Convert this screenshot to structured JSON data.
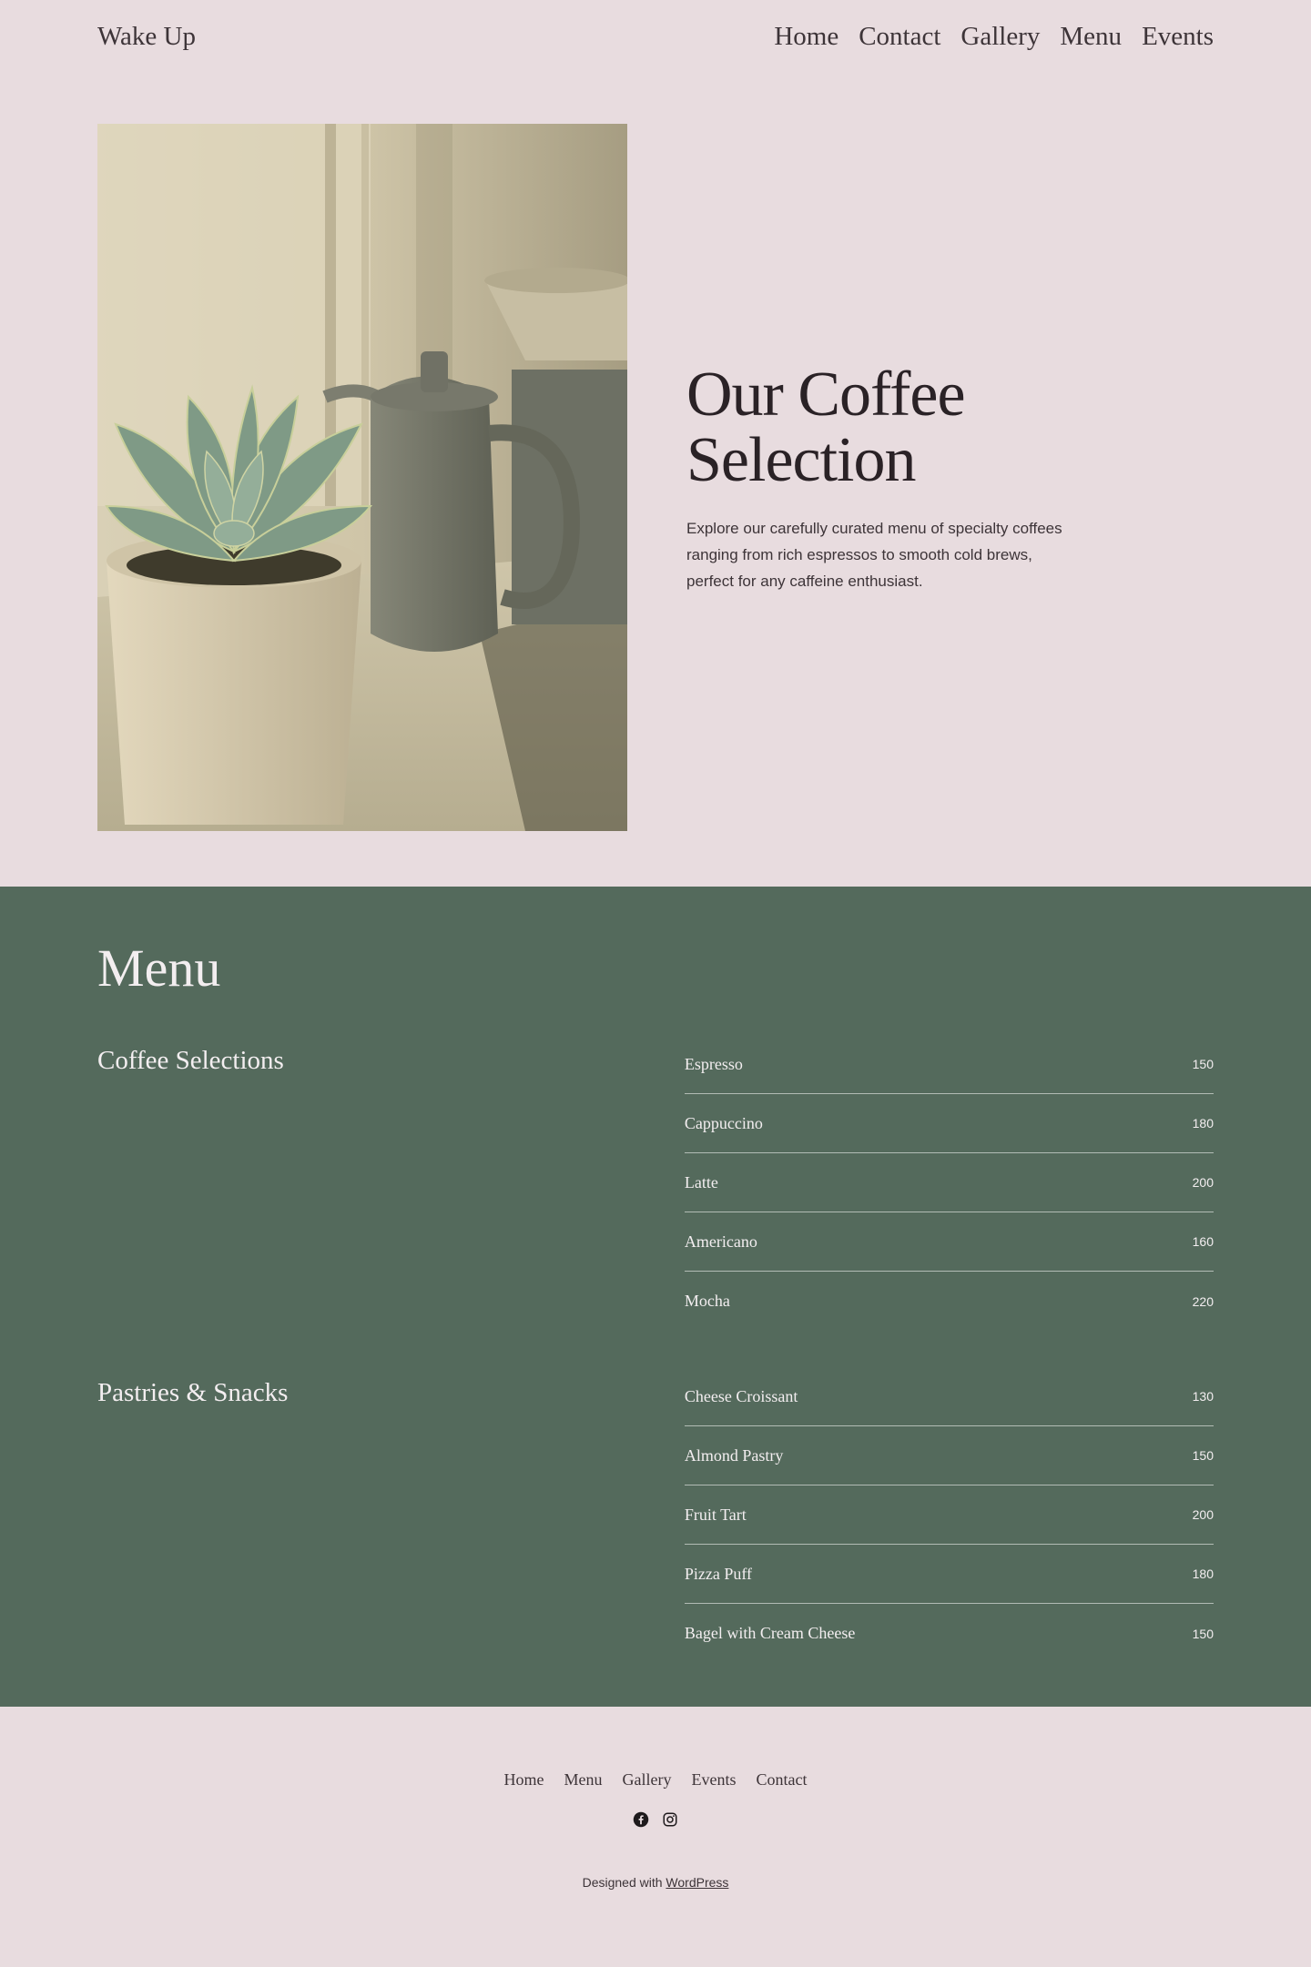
{
  "header": {
    "site_title": "Wake Up",
    "nav": [
      "Home",
      "Contact",
      "Gallery",
      "Menu",
      "Events"
    ]
  },
  "hero": {
    "title_line1": "Our Coffee",
    "title_line2": "Selection",
    "description": "Explore our carefully curated menu of specialty coffees ranging from rich espressos to smooth cold brews, perfect for any caffeine enthusiast."
  },
  "menu": {
    "heading": "Menu",
    "groups": [
      {
        "title": "Coffee Selections",
        "items": [
          {
            "name": "Espresso",
            "price": "150"
          },
          {
            "name": "Cappuccino",
            "price": "180"
          },
          {
            "name": "Latte",
            "price": "200"
          },
          {
            "name": "Americano",
            "price": "160"
          },
          {
            "name": "Mocha",
            "price": "220"
          }
        ]
      },
      {
        "title": "Pastries & Snacks",
        "items": [
          {
            "name": "Cheese Croissant",
            "price": "130"
          },
          {
            "name": "Almond Pastry",
            "price": "150"
          },
          {
            "name": "Fruit Tart",
            "price": "200"
          },
          {
            "name": "Pizza Puff",
            "price": "180"
          },
          {
            "name": "Bagel with Cream Cheese",
            "price": "150"
          }
        ]
      }
    ]
  },
  "footer": {
    "nav": [
      "Home",
      "Menu",
      "Gallery",
      "Events",
      "Contact"
    ],
    "social_icons": [
      "facebook-icon",
      "instagram-icon"
    ],
    "credit_prefix": "Designed with ",
    "credit_link": "WordPress"
  },
  "colors": {
    "background": "#e8dcdf",
    "menu_background": "#546a5c",
    "text_dark": "#2a2226",
    "text_light": "#f3eef0"
  }
}
